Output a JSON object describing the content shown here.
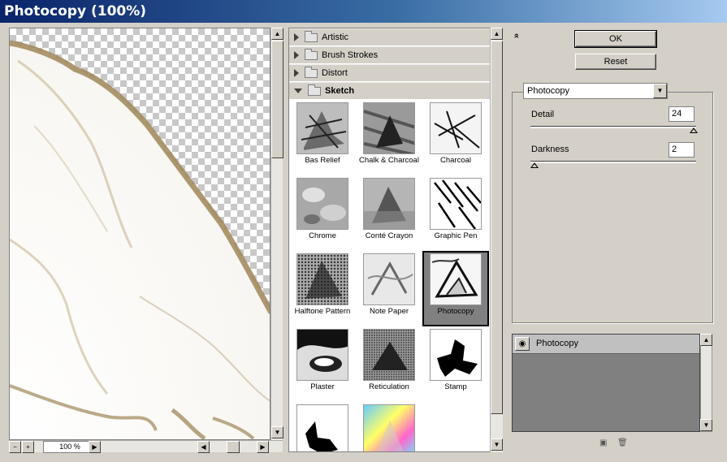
{
  "window": {
    "title": "Photocopy (100%)"
  },
  "preview": {
    "zoom": "100 %",
    "zoom_out": "−",
    "zoom_in": "+"
  },
  "gallery": {
    "categories": [
      {
        "label": "Artistic",
        "open": false
      },
      {
        "label": "Brush Strokes",
        "open": false
      },
      {
        "label": "Distort",
        "open": false
      },
      {
        "label": "Sketch",
        "open": true
      }
    ],
    "filters": [
      {
        "label": "Bas Relief",
        "selected": false
      },
      {
        "label": "Chalk & Charcoal",
        "selected": false
      },
      {
        "label": "Charcoal",
        "selected": false
      },
      {
        "label": "Chrome",
        "selected": false
      },
      {
        "label": "Conté Crayon",
        "selected": false
      },
      {
        "label": "Graphic Pen",
        "selected": false
      },
      {
        "label": "Halftone Pattern",
        "selected": false
      },
      {
        "label": "Note Paper",
        "selected": false
      },
      {
        "label": "Photocopy",
        "selected": true
      },
      {
        "label": "Plaster",
        "selected": false
      },
      {
        "label": "Reticulation",
        "selected": false
      },
      {
        "label": "Stamp",
        "selected": false
      },
      {
        "label": "",
        "selected": false
      },
      {
        "label": "",
        "selected": false
      }
    ]
  },
  "buttons": {
    "ok": "OK",
    "reset": "Reset",
    "collapse": "»"
  },
  "settings": {
    "filter_select": "Photocopy",
    "detail": {
      "label": "Detail",
      "value": "24",
      "min": 1,
      "max": 24
    },
    "darkness": {
      "label": "Darkness",
      "value": "2",
      "min": 1,
      "max": 50
    }
  },
  "layers": {
    "items": [
      {
        "name": "Photocopy",
        "visible": true
      }
    ]
  },
  "colors": {
    "title_start": "#0a246a",
    "title_end": "#a6caf0",
    "selected_cell": "#808080",
    "sepia": "#a08658"
  }
}
